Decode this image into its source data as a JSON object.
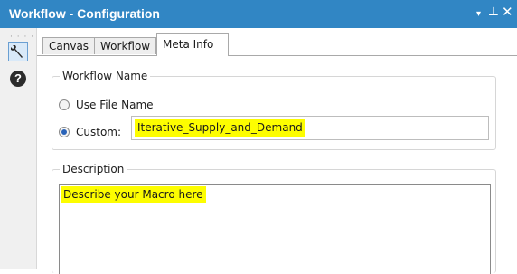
{
  "window": {
    "title": "Workflow - Configuration",
    "controls": {
      "dropdown": "▾",
      "pin": "⊥",
      "close": "✕"
    }
  },
  "toolbar": {
    "grip": "· · · ·",
    "configure_icon": "wrench-icon",
    "help_icon": "help-icon",
    "help_glyph": "?"
  },
  "tabs": [
    {
      "label": "Canvas",
      "active": false
    },
    {
      "label": "Workflow",
      "active": false
    },
    {
      "label": "Meta Info",
      "active": true
    }
  ],
  "workflow_name": {
    "legend": "Workflow Name",
    "options": [
      {
        "label": "Use File Name",
        "selected": false
      },
      {
        "label": "Custom:",
        "selected": true
      }
    ],
    "custom_value": "Iterative_Supply_and_Demand"
  },
  "description": {
    "legend": "Description",
    "value": "Describe your Macro here"
  },
  "colors": {
    "title_bar": "#3186c4",
    "highlight": "#fdfd00",
    "active_tool": "#d9e9f8"
  }
}
